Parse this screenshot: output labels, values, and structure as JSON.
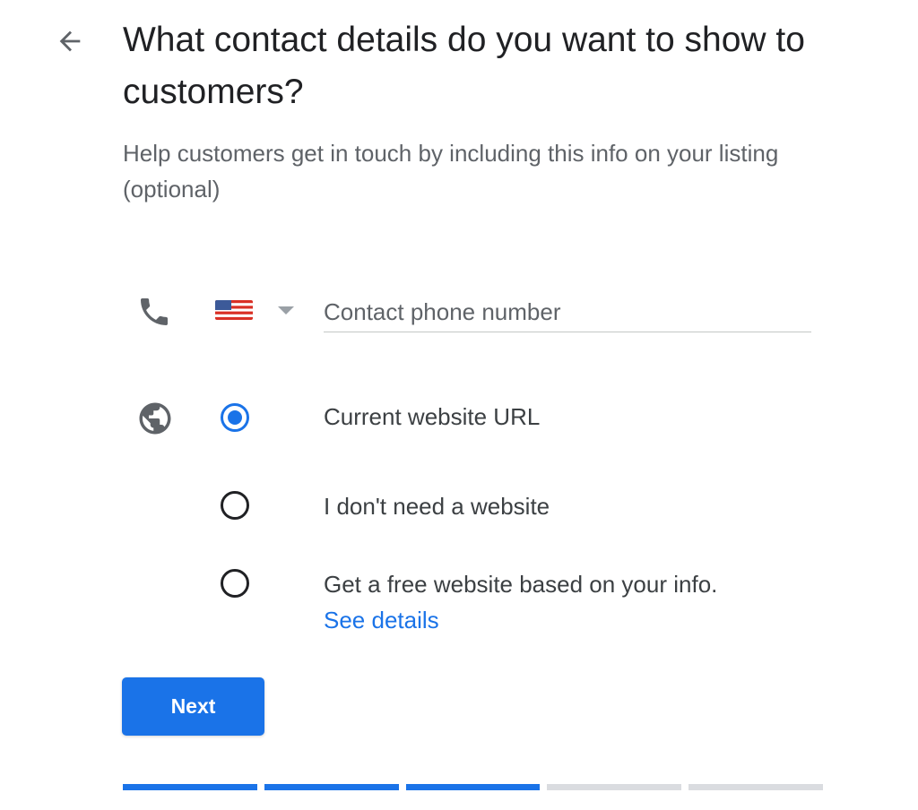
{
  "header": {
    "back_icon": "arrow-back-icon",
    "title": "What contact details do you want to show to customers?",
    "subtitle": "Help customers get in touch by including this info on your listing (optional)"
  },
  "phone": {
    "icon": "phone-icon",
    "country_flag": "us-flag-icon",
    "placeholder": "Contact phone number",
    "value": ""
  },
  "website": {
    "icon": "globe-icon",
    "selected_index": 0,
    "options": [
      {
        "label": "Current website URL"
      },
      {
        "label": "I don't need a website"
      },
      {
        "label": "Get a free website based on your info.",
        "link": "See details"
      }
    ]
  },
  "actions": {
    "next_label": "Next"
  },
  "progress": {
    "total_steps": 5,
    "completed_steps": 3
  },
  "colors": {
    "accent": "#1a73e8",
    "text_primary": "#202124",
    "text_secondary": "#5f6368",
    "progress_inactive": "#dadce0"
  }
}
